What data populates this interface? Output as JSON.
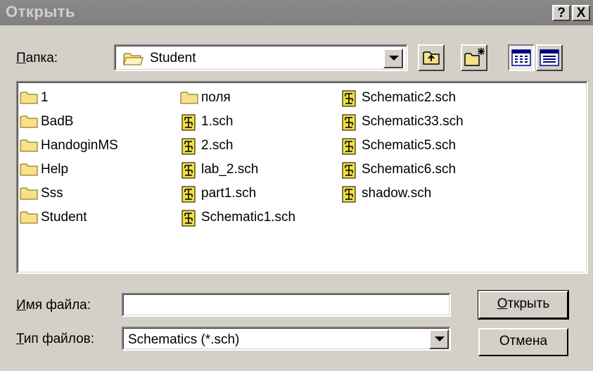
{
  "title": "Открыть",
  "title_buttons": {
    "help": "?",
    "close": "X"
  },
  "lookin": {
    "label_accel": "П",
    "label_rest": "апка:",
    "value": "Student"
  },
  "toolbar": {
    "up_icon": "folder-up-icon",
    "new_folder_icon": "new-folder-icon",
    "list_view_icon": "list-view-icon",
    "details_view_icon": "details-view-icon"
  },
  "files": {
    "col1": [
      "1",
      "BadB",
      "HandoginMS",
      "Help",
      "Sss",
      "Student"
    ],
    "col2": [
      "поля",
      "1.sch",
      "2.sch",
      "lab_2.sch",
      "part1.sch",
      "Schematic1.sch"
    ],
    "col3": [
      "Schematic2.sch",
      "Schematic33.sch",
      "Schematic5.sch",
      "Schematic6.sch",
      "shadow.sch"
    ]
  },
  "filename": {
    "label_accel": "И",
    "label_rest": "мя файла:",
    "value": ""
  },
  "filetype": {
    "label_accel": "Т",
    "label_rest": "ип файлов:",
    "value": "Schematics (*.sch)"
  },
  "buttons": {
    "open_accel": "О",
    "open_rest": "ткрыть",
    "cancel": "Отмена"
  },
  "colors": {
    "face": "#d4d0c8",
    "title_bar": "#808080",
    "folder": "#f6e08a",
    "file_icon": "#f0e040"
  }
}
